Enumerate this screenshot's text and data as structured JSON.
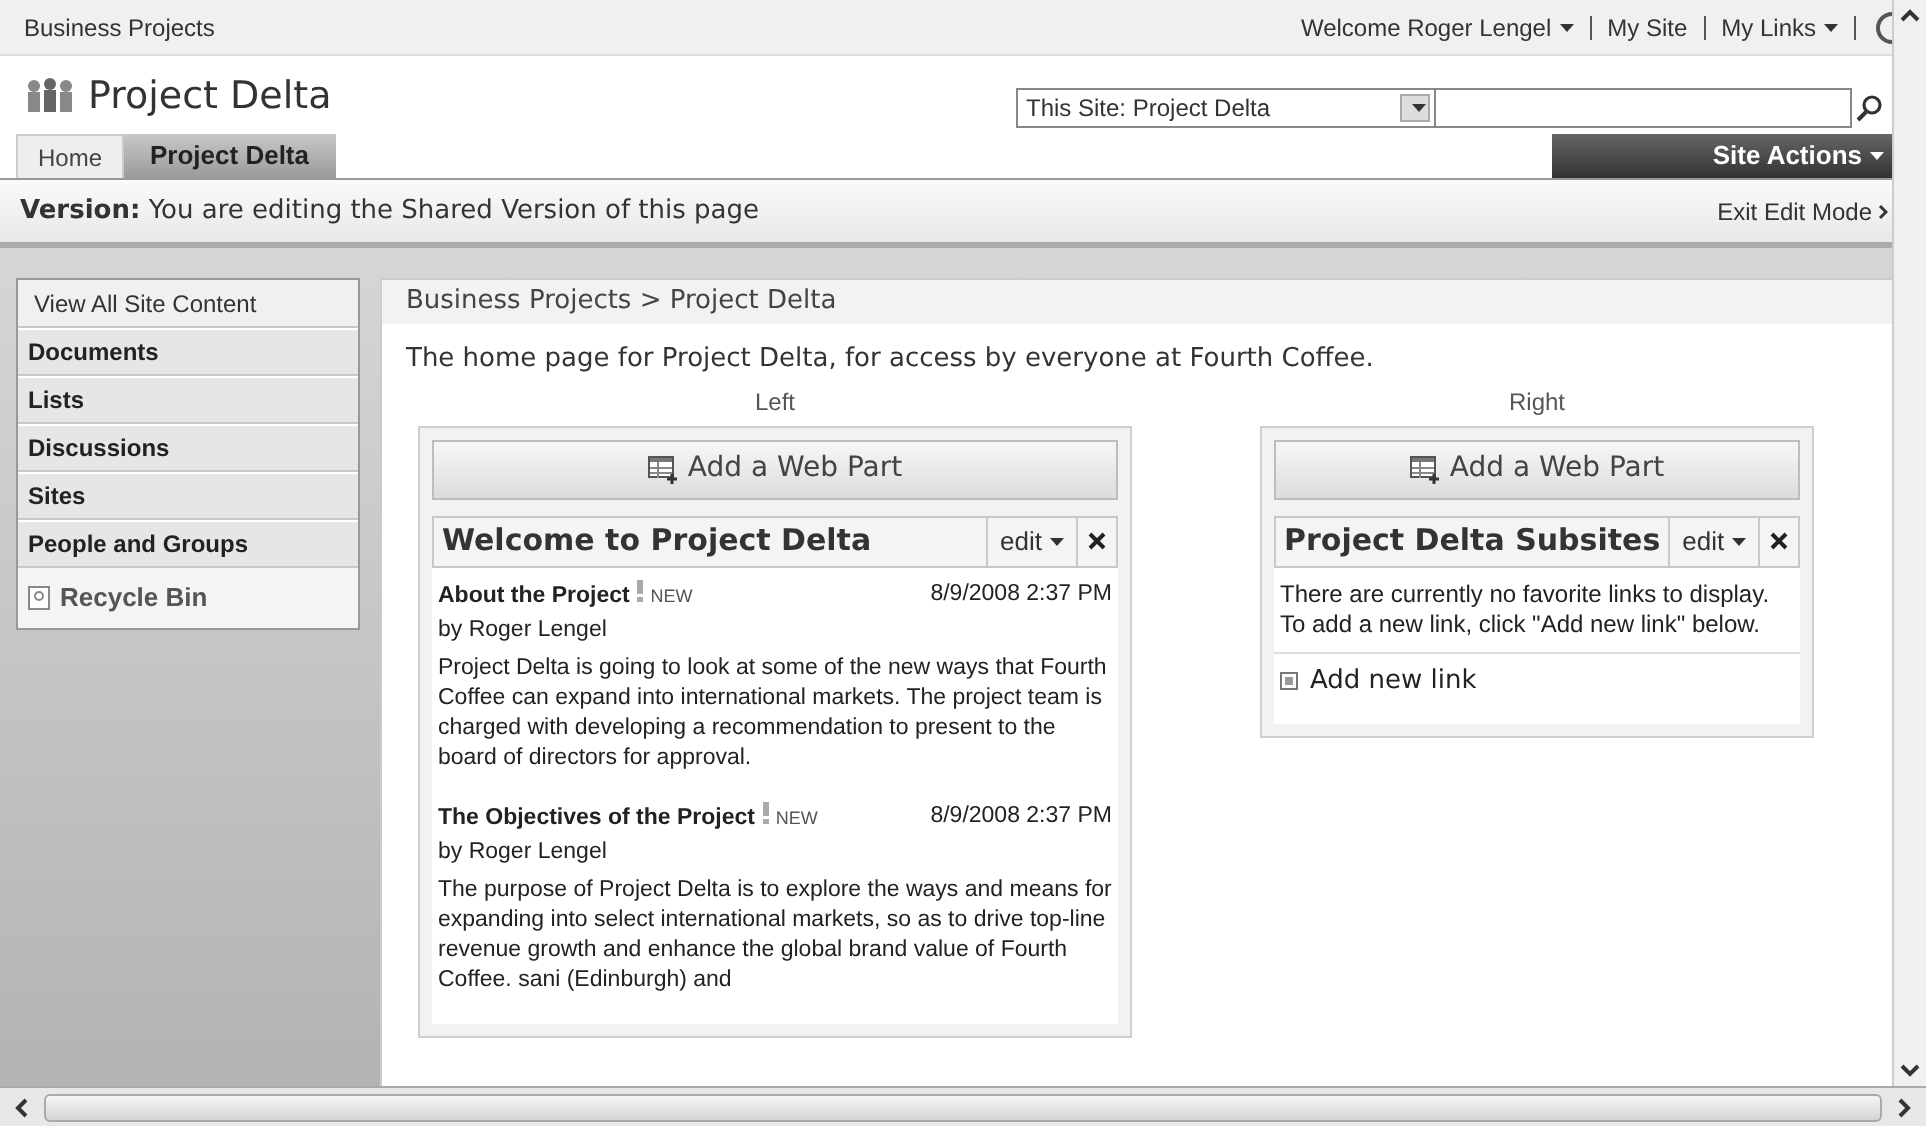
{
  "top_bar": {
    "site": "Business Projects",
    "welcome": "Welcome Roger Lengel",
    "my_site": "My Site",
    "my_links": "My Links"
  },
  "header": {
    "title": "Project Delta",
    "search_scope": "This Site: Project Delta"
  },
  "tabs": [
    {
      "label": "Home",
      "selected": false
    },
    {
      "label": "Project Delta",
      "selected": true
    }
  ],
  "site_actions": "Site Actions",
  "version_bar": {
    "label": "Version:",
    "text": "You are editing the Shared Version of this page",
    "exit": "Exit Edit Mode"
  },
  "quick_launch": [
    {
      "label": "View All Site Content",
      "kind": "link"
    },
    {
      "label": "Documents",
      "kind": "heading"
    },
    {
      "label": "Lists",
      "kind": "heading"
    },
    {
      "label": "Discussions",
      "kind": "heading"
    },
    {
      "label": "Sites",
      "kind": "heading"
    },
    {
      "label": "People and Groups",
      "kind": "heading"
    },
    {
      "label": "Recycle Bin",
      "kind": "recycle"
    }
  ],
  "breadcrumb": "Business Projects > Project Delta",
  "description": "The home page for Project Delta, for access by everyone at Fourth Coffee.",
  "zones": [
    {
      "label": "Left",
      "add_button": "Add a Web Part",
      "web_part": {
        "title": "Welcome to Project Delta",
        "edit": "edit",
        "kind": "announcements",
        "items": [
          {
            "title": "About the Project",
            "badge": "NEW",
            "date": "8/9/2008 2:37 PM",
            "author": "by Roger Lengel",
            "body": "Project Delta is going to look at some of the new ways that Fourth Coffee can expand into international markets. The project team is charged with developing a recommendation to present to the board of directors for approval."
          },
          {
            "title": "The Objectives of the Project",
            "badge": "NEW",
            "date": "8/9/2008 2:37 PM",
            "author": "by Roger Lengel",
            "body": "The purpose of Project Delta is to explore the ways and means for expanding into select international markets, so as to drive top-line revenue growth and enhance the global brand value of Fourth Coffee. sani (Edinburgh) and"
          }
        ]
      }
    },
    {
      "label": "Right",
      "add_button": "Add a Web Part",
      "web_part": {
        "title": "Project Delta Subsites",
        "edit": "edit",
        "kind": "links",
        "message": "There are currently no favorite links to display. To add a new link, click \"Add new link\" below.",
        "add_link": "Add new link"
      }
    }
  ]
}
